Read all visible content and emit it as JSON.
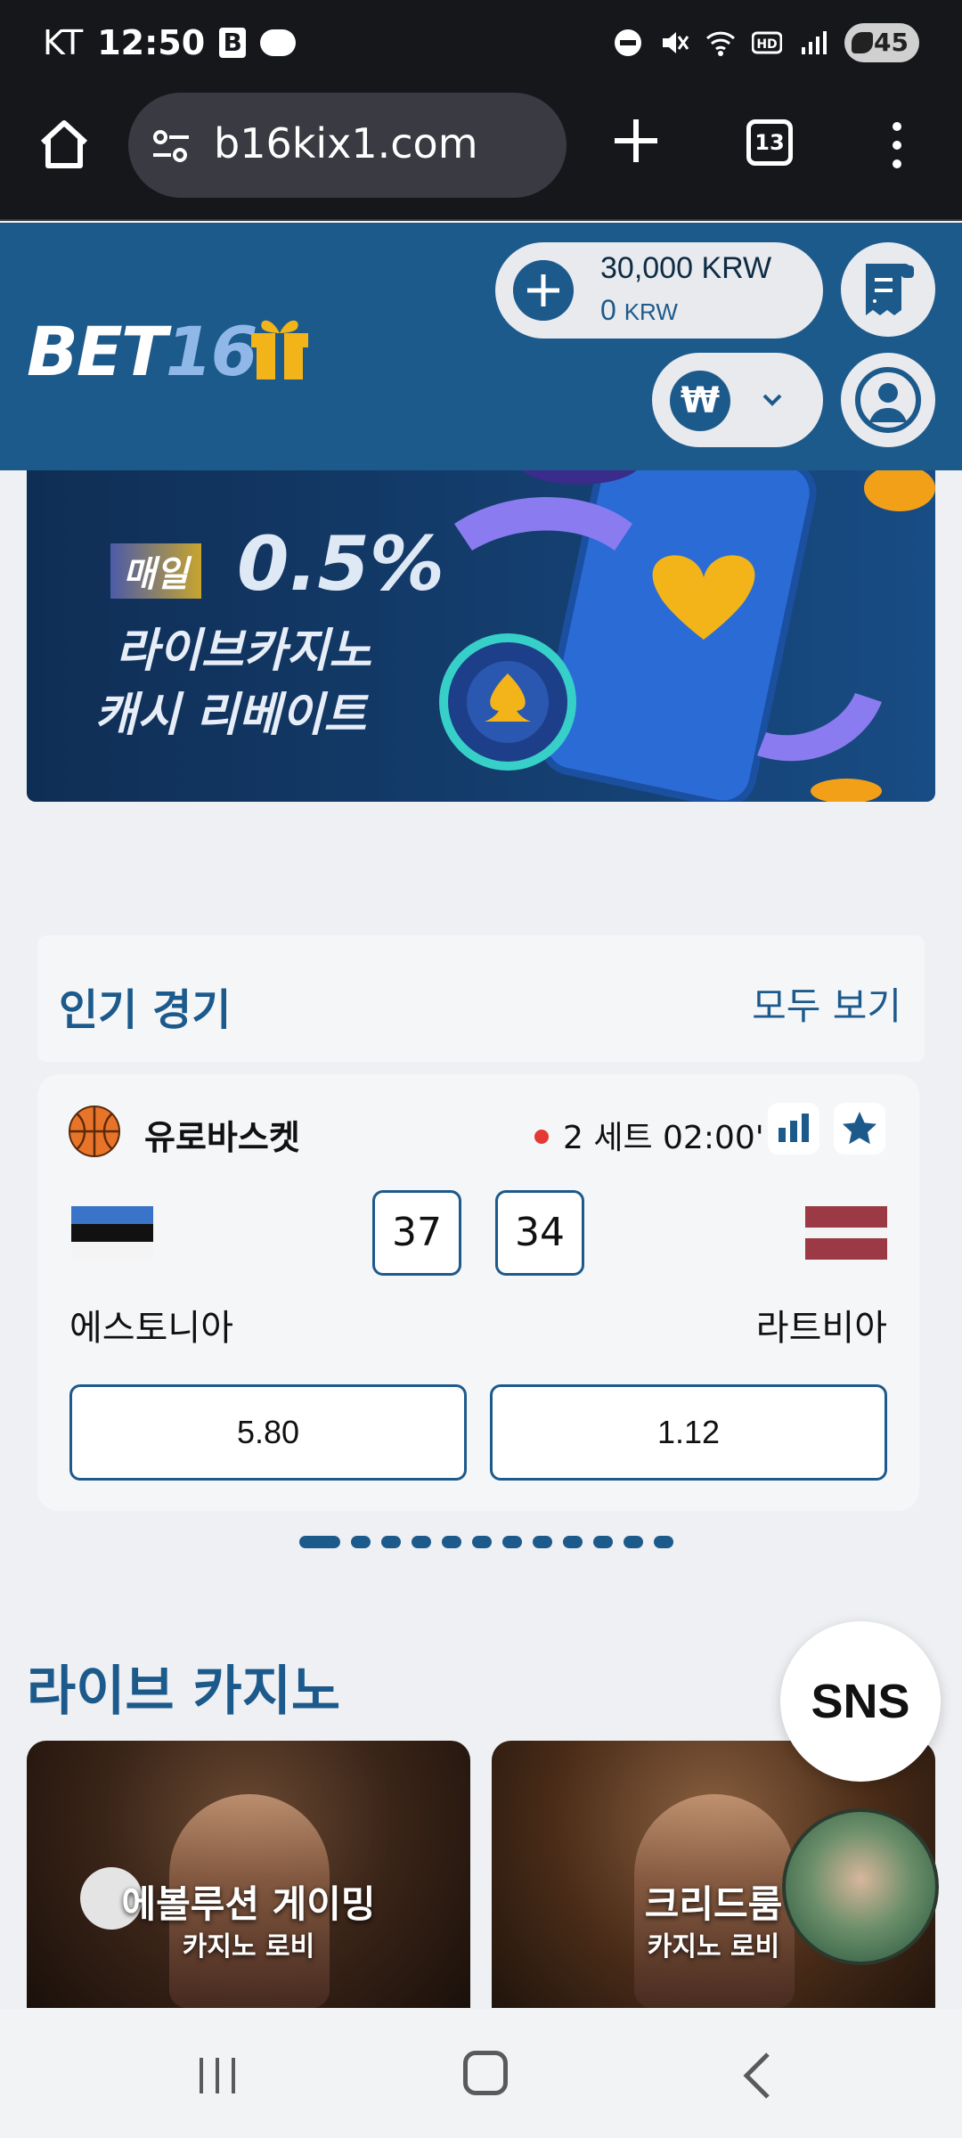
{
  "status_bar": {
    "carrier": "KT",
    "time": "12:50",
    "battery": "45"
  },
  "browser": {
    "url": "b16kix1.com",
    "tab_count": "13"
  },
  "header": {
    "logo_text": "BET",
    "logo_number": "16",
    "balance_main": "30,000 KRW",
    "balance_sub_value": "0",
    "balance_sub_unit": "KRW",
    "currency_symbol": "₩"
  },
  "banner": {
    "tag": "매일",
    "percent": "0.5%",
    "line2": "라이브카지노",
    "line3": "캐시 리베이트"
  },
  "popular": {
    "title": "인기 경기",
    "view_all": "모두 보기"
  },
  "match": {
    "league": "유로바스켓",
    "time": "2 세트 02:00'",
    "home_team": "에스토니아",
    "away_team": "라트비아",
    "home_score": "37",
    "away_score": "34",
    "home_odds": "5.80",
    "away_odds": "1.12"
  },
  "pager": {
    "total": 12,
    "active": 0
  },
  "casino": {
    "title": "라이브 카지노",
    "sns_label": "SNS",
    "games": [
      {
        "name": "에볼루션 게이밍",
        "sub": "카지노 로비"
      },
      {
        "name": "크리드룸",
        "sub": "카지노 로비"
      }
    ]
  },
  "colors": {
    "brand_blue": "#1d5a8c",
    "live_red": "#e53935",
    "gift_gold": "#f2b418"
  }
}
